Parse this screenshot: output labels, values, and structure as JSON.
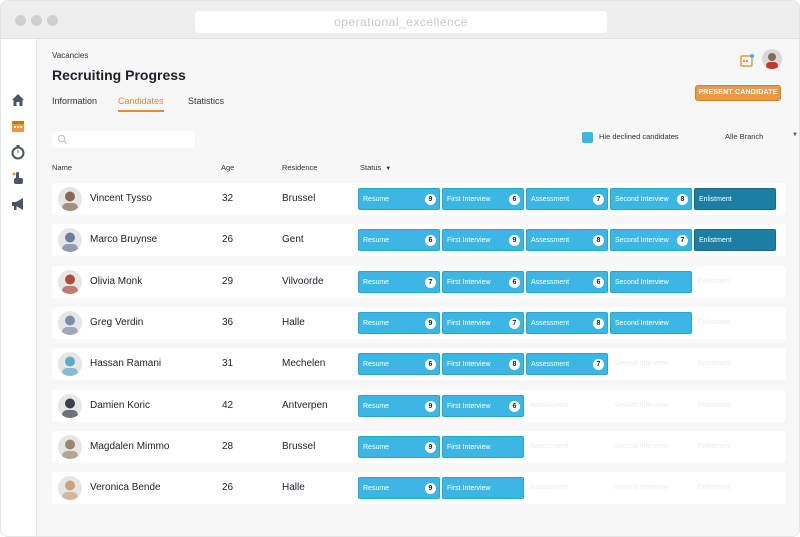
{
  "window": {
    "url": "operational_excellence"
  },
  "sidebar": {
    "icons": [
      "home-icon",
      "calendar-icon",
      "stopwatch-icon",
      "hand-icon",
      "megaphone-icon"
    ]
  },
  "header": {
    "breadcrumb": "Vacancies",
    "title": "Recruiting Progress"
  },
  "tabs": [
    {
      "label": "Information",
      "active": false
    },
    {
      "label": "Candidates",
      "active": true
    },
    {
      "label": "Statistics",
      "active": false
    }
  ],
  "actions": {
    "present_label": "PRESENT CANDIDATE"
  },
  "filters": {
    "search_placeholder": "",
    "hide_declined_label": "Hie declined candidates",
    "branch_label": "Alle Branch"
  },
  "table": {
    "columns": {
      "name": "Name",
      "age": "Age",
      "residence": "Residence",
      "status": "Status"
    },
    "stage_labels": [
      "Resume",
      "First Interview",
      "Assessment",
      "Second Interview",
      "Enlistment"
    ],
    "rows": [
      {
        "name": "Vincent Tysso",
        "age": "32",
        "residence": "Brussel",
        "counts": [
          "9",
          "6",
          "7",
          "8",
          ""
        ],
        "progress": 5,
        "avatar_color": "#8a6a55"
      },
      {
        "name": "Marco Bruynse",
        "age": "26",
        "residence": "Gent",
        "counts": [
          "6",
          "9",
          "8",
          "7",
          ""
        ],
        "progress": 5,
        "avatar_color": "#6b7d9a"
      },
      {
        "name": "Olivia Monk",
        "age": "29",
        "residence": "Vilvoorde",
        "counts": [
          "7",
          "6",
          "6",
          "",
          ""
        ],
        "progress": 4,
        "avatar_color": "#b04a3c"
      },
      {
        "name": "Greg Verdin",
        "age": "36",
        "residence": "Halle",
        "counts": [
          "9",
          "7",
          "8",
          "",
          ""
        ],
        "progress": 4,
        "avatar_color": "#7d8fa8"
      },
      {
        "name": "Hassan Ramani",
        "age": "31",
        "residence": "Mechelen",
        "counts": [
          "6",
          "8",
          "7",
          "",
          ""
        ],
        "progress": 3,
        "avatar_color": "#5fa9c9"
      },
      {
        "name": "Damien Koric",
        "age": "42",
        "residence": "Antverpen",
        "counts": [
          "9",
          "6",
          "",
          "",
          ""
        ],
        "progress": 2,
        "avatar_color": "#3a3f48"
      },
      {
        "name": "Magdalen Mimmo",
        "age": "28",
        "residence": "Brussel",
        "counts": [
          "9",
          "",
          "",
          "",
          ""
        ],
        "progress": 2,
        "avatar_color": "#9c8870"
      },
      {
        "name": "Veronica Bende",
        "age": "26",
        "residence": "Halle",
        "counts": [
          "9",
          "",
          "",
          "",
          ""
        ],
        "progress": 2,
        "avatar_color": "#c9a27a"
      }
    ]
  },
  "colors": {
    "accent": "#e68a2e",
    "stage_active": "#3cb7e3",
    "stage_final": "#1c7ea3"
  }
}
